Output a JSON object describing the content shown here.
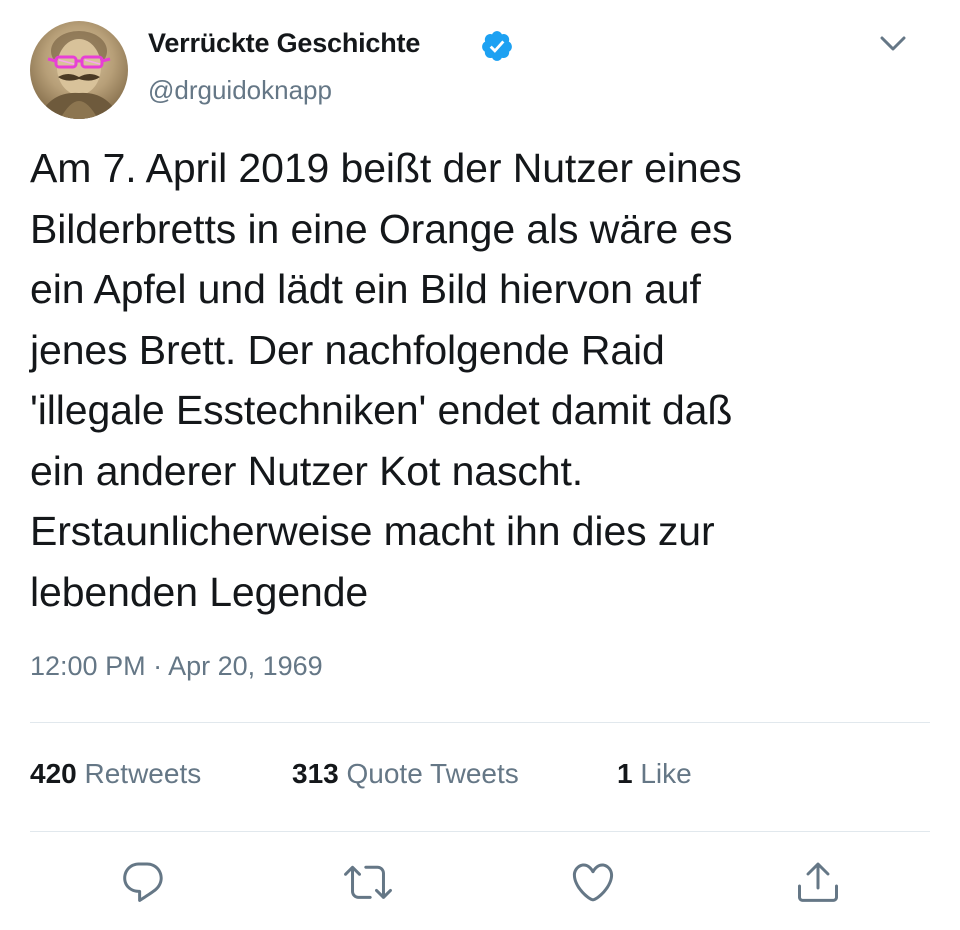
{
  "tweet": {
    "author": {
      "display_name": "Verrückte Geschichte",
      "handle": "@drguidoknapp",
      "verified": true,
      "avatar_icon": "portrait-with-pink-glasses"
    },
    "text": "Am 7. April 2019 beißt der Nutzer eines\nBilderbretts in eine Orange als wäre es\nein Apfel und lädt ein Bild hiervon auf\njenes Brett. Der nachfolgende Raid\n'illegale Esstechniken' endet damit daß\nein anderer Nutzer Kot nascht.\nErstaunlicherweise macht ihn dies zur\nlebenden Legende",
    "timestamp": "12:00 PM · Apr 20, 1969",
    "stats": {
      "retweets_count": "420",
      "retweets_label": "Retweets",
      "quote_tweets_count": "313",
      "quote_tweets_label": "Quote Tweets",
      "likes_count": "1",
      "likes_label": "Like"
    },
    "actions": [
      "reply-icon",
      "retweet-icon",
      "like-icon",
      "share-icon"
    ]
  },
  "colors": {
    "text": "#14171a",
    "secondary_text": "#657786",
    "verified_blue": "#1da1f2",
    "divider": "#e1e8ed",
    "glasses_pink": "#e83fd6"
  }
}
